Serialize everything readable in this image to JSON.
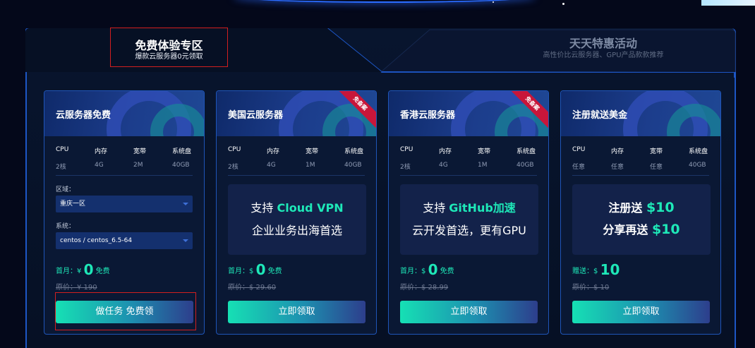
{
  "tabs": {
    "active": {
      "title": "免费体验专区",
      "subtitle": "爆款云服务器0元领取"
    },
    "inactive": {
      "title": "天天特惠活动",
      "subtitle": "高性价比云服务器、GPU产品款款推荐"
    }
  },
  "colors": {
    "accent": "#1ee8b8",
    "border": "#1d56c5",
    "ribbon": "#c8163a",
    "highlight_box": "#d21f1f"
  },
  "spec_labels": [
    "CPU",
    "内存",
    "宽带",
    "系统盘"
  ],
  "cards": [
    {
      "title": "云服务器免费",
      "specs": [
        "2核",
        "4G",
        "2M",
        "40GB"
      ],
      "region_label": "区域：",
      "region_value": "重庆一区",
      "system_label": "系统：",
      "system_value": "centos / centos_6.5-64",
      "price_label": "首月：",
      "currency": "¥",
      "price": "0",
      "price_suffix": "免费",
      "original": "原价：¥ 190",
      "button": "做任务 免费领"
    },
    {
      "title": "美国云服务器",
      "ribbon": "免备案",
      "specs": [
        "2核",
        "4G",
        "1M",
        "40GB"
      ],
      "promo_prefix": "支持 ",
      "promo_highlight": "Cloud VPN",
      "promo_line2": "企业业务出海首选",
      "price_label": "首月：",
      "currency": "$",
      "price": "0",
      "price_suffix": "免费",
      "original": "原价：$ 29.60",
      "button": "立即领取"
    },
    {
      "title": "香港云服务器",
      "ribbon": "免备案",
      "specs": [
        "2核",
        "4G",
        "1M",
        "40GB"
      ],
      "promo_prefix": "支持 ",
      "promo_highlight": "GitHub加速",
      "promo_line2": "云开发首选，更有GPU",
      "price_label": "首月：",
      "currency": "$",
      "price": "0",
      "price_suffix": "免费",
      "original": "原价：$ 28.99",
      "button": "立即领取"
    },
    {
      "title": "注册就送美金",
      "specs": [
        "任意",
        "任意",
        "任意",
        "40GB"
      ],
      "promo_l1_prefix": "注册送 ",
      "promo_l1_amount": "$10",
      "promo_l2_prefix": "分享再送 ",
      "promo_l2_amount": "$10",
      "price_label": "赠送：",
      "currency": "$",
      "price": "10",
      "price_suffix": "",
      "original": "原价：$ 10",
      "button": "立即领取"
    }
  ]
}
